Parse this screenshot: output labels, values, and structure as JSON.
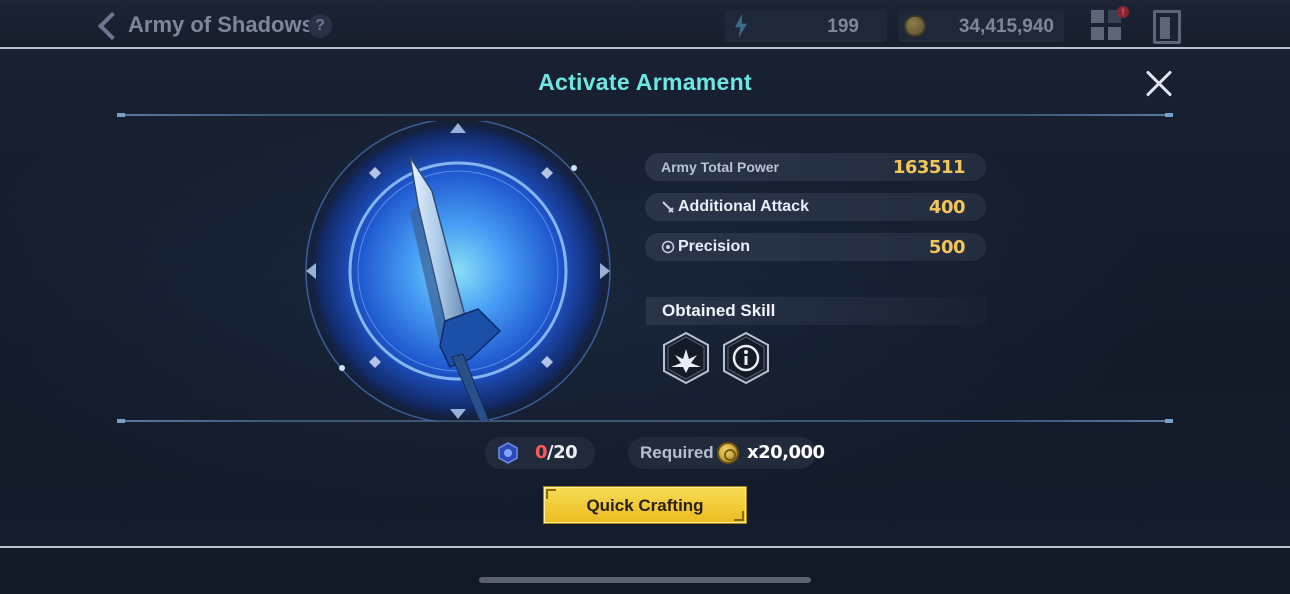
{
  "header": {
    "title": "Army of Shadows",
    "help_icon": "question-icon",
    "resources": [
      {
        "icon": "energy-icon",
        "value": "199"
      },
      {
        "icon": "gold-coin-icon",
        "value": "34,415,940"
      }
    ],
    "grid_badge": "!"
  },
  "modal": {
    "title": "Activate Armament",
    "close_icon": "close-icon",
    "weapon_icon": "sword-icon",
    "stats": [
      {
        "label": "Army Total Power",
        "value": "163511"
      },
      {
        "label": "Additional Attack",
        "value": "400",
        "icon": "sword-small-icon"
      },
      {
        "label": "Precision",
        "value": "500",
        "icon": "target-icon"
      }
    ],
    "skill_section": {
      "label": "Obtained Skill",
      "skills": [
        {
          "icon": "burst-skill-icon"
        },
        {
          "icon": "info-icon"
        }
      ]
    },
    "progress": {
      "current": "0",
      "separator": "/",
      "max": "20"
    },
    "required": {
      "label": "Required",
      "amount": "x20,000"
    },
    "craft_button": "Quick Crafting"
  },
  "colors": {
    "title_cyan": "#6fe6e1",
    "stat_gold": "#f3c65a",
    "progress_red": "#ff5a55",
    "button_yellow": "#f2cc3a"
  }
}
